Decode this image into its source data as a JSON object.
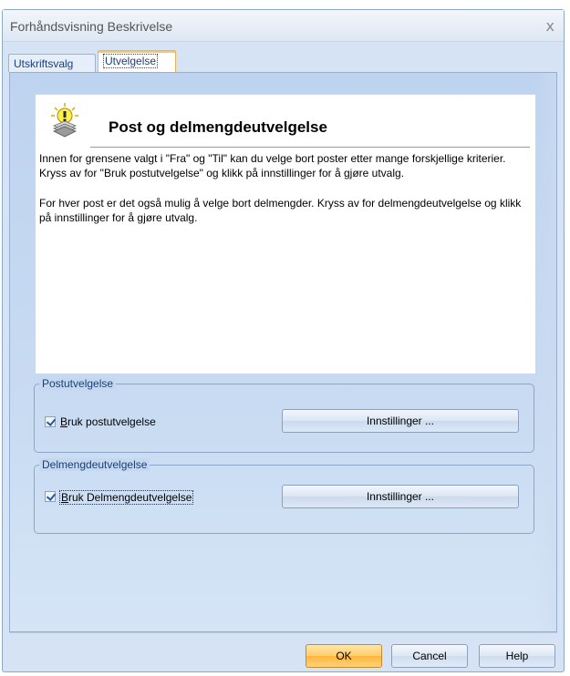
{
  "window": {
    "title": "Forhåndsvisning Beskrivelse",
    "close_glyph": "x"
  },
  "tabs": [
    {
      "label": "Utskriftsvalg",
      "selected": false
    },
    {
      "label": "Utvelgelse",
      "selected": true
    }
  ],
  "info": {
    "icon": "lightbulb-icon",
    "heading": "Post og delmengdeutvelgelse",
    "paragraph1": "Innen for grensene valgt i \"Fra\" og \"Til\" kan du velge bort poster etter mange forskjellige kriterier. Kryss av for \"Bruk postutvelgelse\" og klikk på innstillinger for å gjøre utvalg.",
    "paragraph2": "For hver post er det også mulig å velge bort delmengder. Kryss av for delmengdeutvelgelse og klikk på innstillinger for å gjøre utvalg."
  },
  "postutvelgelse": {
    "legend": "Postutvelgelse",
    "checkbox_mnemonic": "B",
    "checkbox_rest": "ruk postutvelgelse",
    "checked": true,
    "button_label": "Innstillinger ..."
  },
  "delmengdeutvelgelse": {
    "legend": "Delmengdeutvelgelse",
    "checkbox_mnemonic": "B",
    "checkbox_rest": "ruk Delmengdeutvelgelse",
    "checked": true,
    "button_label": "Innstillinger ..."
  },
  "footer": {
    "ok_label": "OK",
    "cancel_label": "Cancel",
    "help_label": "Help"
  },
  "colors": {
    "accent_ok": "#ffcd6d",
    "panel_bg": "#c8dbf2",
    "title_text": "#555555"
  }
}
